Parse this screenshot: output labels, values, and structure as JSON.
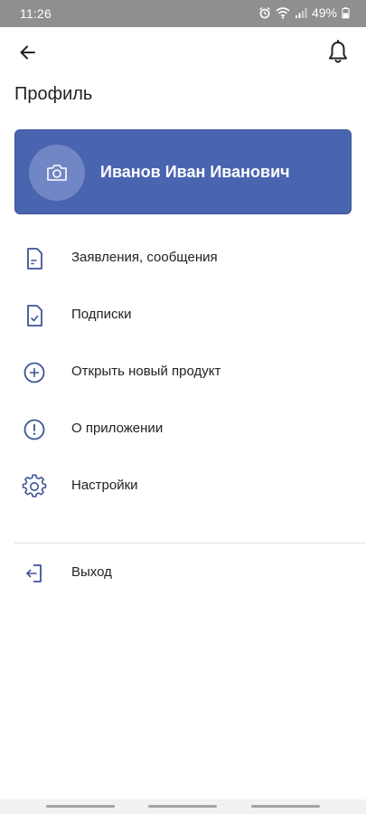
{
  "status_bar": {
    "time": "11:26",
    "battery": "49%",
    "icons": [
      "alarm-icon",
      "wifi-icon",
      "signal-icon",
      "battery-icon"
    ]
  },
  "header": {
    "back_icon": "arrow-left-icon",
    "notifications_icon": "bell-icon",
    "title": "Профиль"
  },
  "profile": {
    "name": "Иванов Иван Иванович",
    "avatar_icon": "camera-icon",
    "card_color": "#4a65b0"
  },
  "menu": {
    "items": [
      {
        "label": "Заявления, сообщения",
        "icon": "document-icon"
      },
      {
        "label": "Подписки",
        "icon": "document-check-icon"
      },
      {
        "label": "Открыть новый продукт",
        "icon": "plus-circle-icon"
      },
      {
        "label": "О приложении",
        "icon": "info-circle-icon"
      },
      {
        "label": "Настройки",
        "icon": "gear-icon"
      }
    ],
    "logout": {
      "label": "Выход",
      "icon": "logout-icon"
    }
  },
  "colors": {
    "accent": "#4a65b0",
    "icon": "#3d5495",
    "status_bar": "#8f8f8f"
  }
}
